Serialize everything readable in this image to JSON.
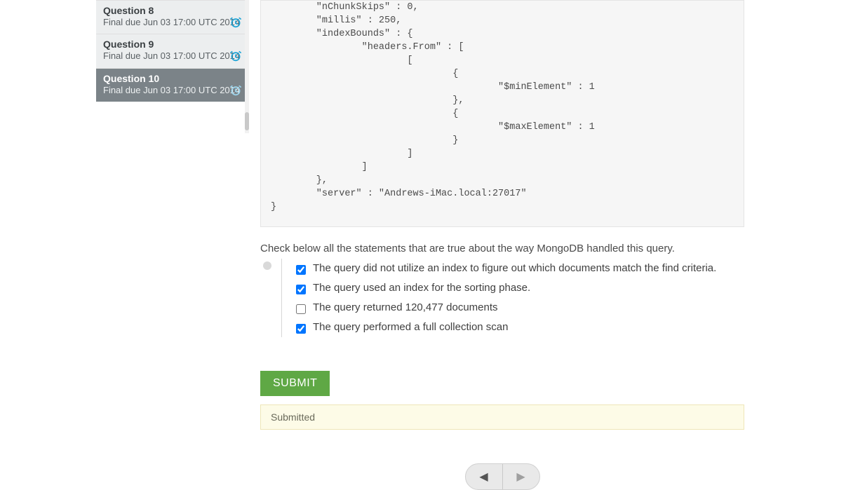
{
  "sidebar": {
    "items": [
      {
        "title": "Question 8",
        "sub": "Final due Jun 03 17:00 UTC 2014",
        "active": false
      },
      {
        "title": "Question 9",
        "sub": "Final due Jun 03 17:00 UTC 2014",
        "active": false
      },
      {
        "title": "Question 10",
        "sub": "Final due Jun 03 17:00 UTC 2014",
        "active": true
      }
    ],
    "clock_icon_color": "#1aa3d6",
    "clock_icon_color_active": "#9dd7ef"
  },
  "code": "        \"nChunkSkips\" : 0,\n        \"millis\" : 250,\n        \"indexBounds\" : {\n                \"headers.From\" : [\n                        [\n                                {\n                                        \"$minElement\" : 1\n                                },\n                                {\n                                        \"$maxElement\" : 1\n                                }\n                        ]\n                ]\n        },\n        \"server\" : \"Andrews-iMac.local:27017\"\n}",
  "prompt": "Check below all the statements that are true about the way MongoDB handled this query.",
  "options": [
    {
      "label": "The query did not utilize an index to figure out which documents match the find criteria.",
      "checked": true
    },
    {
      "label": "The query used an index for the sorting phase.",
      "checked": true
    },
    {
      "label": "The query returned 120,477 documents",
      "checked": false
    },
    {
      "label": "The query performed a full collection scan",
      "checked": true
    }
  ],
  "submit_label": "SUBMIT",
  "status_text": "Submitted",
  "nav": {
    "prev_glyph": "◀",
    "next_glyph": "▶"
  },
  "colors": {
    "submit_bg": "#5fa845",
    "status_bg": "#fdfbe7"
  }
}
